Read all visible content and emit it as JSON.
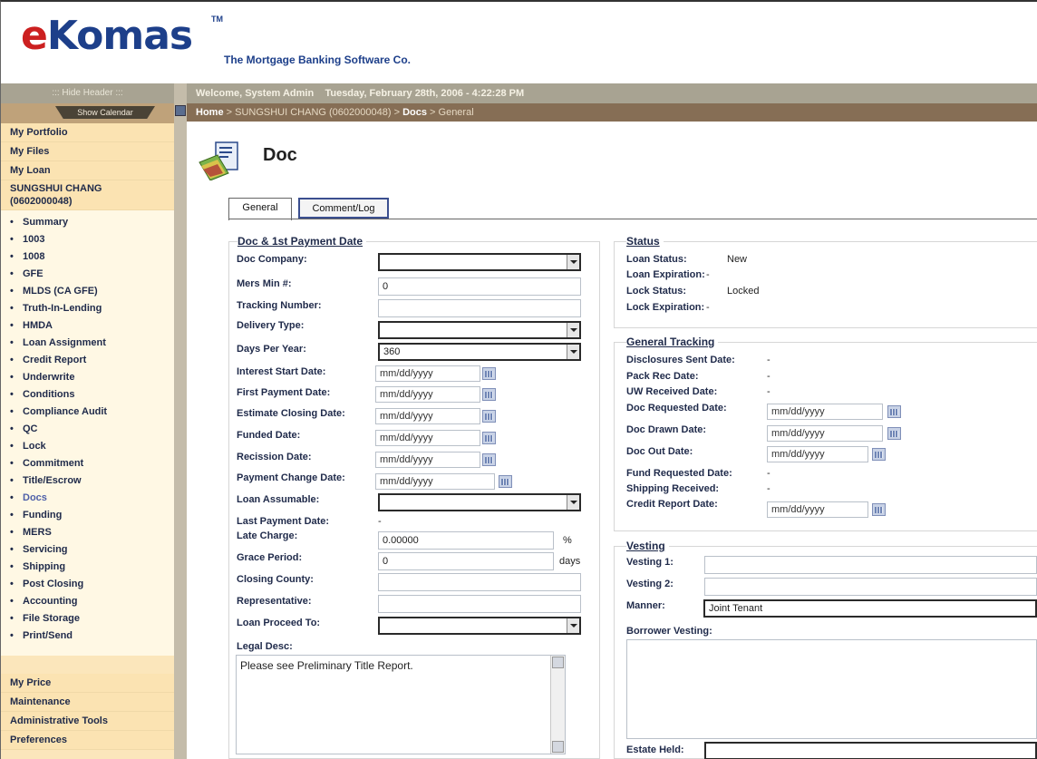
{
  "header": {
    "logo_e": "e",
    "logo_rest": "Komas",
    "logo_tm": "TM",
    "tagline": "The Mortgage Banking Software Co."
  },
  "topbar": {
    "welcome": "Welcome, System Admin",
    "datetime": "Tuesday, February 28th, 2006 - 4:22:28 PM",
    "crumb_home": "Home",
    "crumb_borrower": "SUNGSHUI CHANG (0602000048)",
    "crumb_docs": "Docs",
    "crumb_general": "General",
    "sep": " > "
  },
  "nav": {
    "hide_header": "::: Hide Header :::",
    "show_calendar": "Show Calendar",
    "top_items": [
      "My Portfolio",
      "My Files",
      "My Loan"
    ],
    "borrower_name": "SUNGSHUI CHANG",
    "borrower_id": "(0602000048)",
    "loan_items": [
      "Summary",
      "1003",
      "1008",
      "GFE",
      "MLDS (CA GFE)",
      "Truth-In-Lending",
      "HMDA",
      "Loan Assignment",
      "Credit Report",
      "Underwrite",
      "Conditions",
      "Compliance Audit",
      "QC",
      "Lock",
      "Commitment",
      "Title/Escrow",
      "Docs",
      "Funding",
      "MERS",
      "Servicing",
      "Shipping",
      "Post Closing",
      "Accounting",
      "File Storage",
      "Print/Send"
    ],
    "bottom_items": [
      "My Price",
      "Maintenance",
      "Administrative Tools",
      "Preferences"
    ]
  },
  "page": {
    "title": "Doc",
    "tabs": [
      "General",
      "Comment/Log"
    ]
  },
  "doc_section": {
    "title": "Doc & 1st Payment Date",
    "doc_company_label": "Doc Company:",
    "doc_company_value": "",
    "mers_label": "Mers Min #:",
    "mers_value": "0",
    "tracking_label": "Tracking Number:",
    "tracking_value": "",
    "delivery_label": "Delivery Type:",
    "delivery_value": "",
    "days_label": "Days Per Year:",
    "days_value": "360",
    "interest_start_label": "Interest Start Date:",
    "first_payment_label": "First Payment Date:",
    "est_closing_label": "Estimate Closing Date:",
    "funded_label": "Funded Date:",
    "recission_label": "Recission Date:",
    "payment_change_label": "Payment Change Date:",
    "date_placeholder": "mm/dd/yyyy",
    "assumable_label": "Loan Assumable:",
    "assumable_value": "",
    "last_payment_label": "Last Payment Date:",
    "last_payment_value": "-",
    "late_charge_label": "Late Charge:",
    "late_charge_value": "0.00000",
    "late_charge_unit": "%",
    "grace_label": "Grace Period:",
    "grace_value": "0",
    "grace_unit": "days",
    "county_label": "Closing County:",
    "county_value": "",
    "rep_label": "Representative:",
    "rep_value": "",
    "proceed_label": "Loan Proceed To:",
    "proceed_value": "",
    "legal_label": "Legal Desc:",
    "legal_value": "Please see Preliminary Title Report."
  },
  "status_section": {
    "title": "Status",
    "loan_status_label": "Loan Status:",
    "loan_status_value": "New",
    "loan_exp_label": "Loan Expiration:",
    "loan_exp_value": "-",
    "lock_status_label": "Lock Status:",
    "lock_status_value": "Locked",
    "lock_exp_label": "Lock Expiration:",
    "lock_exp_value": "-"
  },
  "tracking_section": {
    "title": "General Tracking",
    "disclosures_label": "Disclosures Sent Date:",
    "disclosures_value": "-",
    "pack_label": "Pack Rec Date:",
    "pack_value": "-",
    "uw_label": "UW Received Date:",
    "uw_value": "-",
    "doc_req_label": "Doc Requested Date:",
    "doc_drawn_label": "Doc Drawn Date:",
    "doc_out_label": "Doc Out Date:",
    "fund_req_label": "Fund Requested Date:",
    "fund_req_value": "-",
    "shipping_label": "Shipping Received:",
    "shipping_value": "-",
    "credit_label": "Credit Report Date:",
    "date_placeholder": "mm/dd/yyyy"
  },
  "vesting_section": {
    "title": "Vesting",
    "vesting1_label": "Vesting 1:",
    "vesting1_value": "",
    "vesting2_label": "Vesting 2:",
    "vesting2_value": "",
    "manner_label": "Manner:",
    "manner_value": "Joint Tenant",
    "borrower_vesting_label": "Borrower Vesting:",
    "borrower_vesting_value": "",
    "estate_label": "Estate Held:",
    "estate_value": ""
  }
}
